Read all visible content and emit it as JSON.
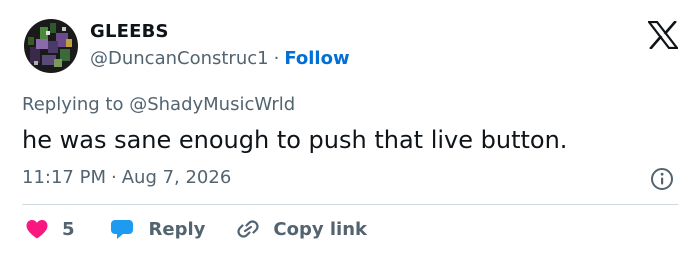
{
  "tweet": {
    "author": {
      "display_name": "GLEEBS",
      "handle": "@DuncanConstruc1",
      "separator": "·",
      "follow_label": "Follow",
      "avatar_icon": "avatar-image"
    },
    "reply_prefix": "Replying to ",
    "reply_to_handle": "@ShadyMusicWrld",
    "text": "he was sane enough to push that live button.",
    "time": "11:17 PM",
    "date_separator": "·",
    "date": "Aug 7, 2026",
    "actions": {
      "like_count": "5",
      "reply_label": "Reply",
      "copy_link_label": "Copy link"
    },
    "colors": {
      "like": "#f91880",
      "reply_bubble": "#1d9bf0",
      "link": "#006fd6",
      "muted": "#536471",
      "text": "#0f1419"
    },
    "icons": {
      "brand": "x-logo-icon",
      "info": "info-icon",
      "like": "heart-icon",
      "reply": "chat-bubble-icon",
      "copy": "link-icon"
    }
  }
}
